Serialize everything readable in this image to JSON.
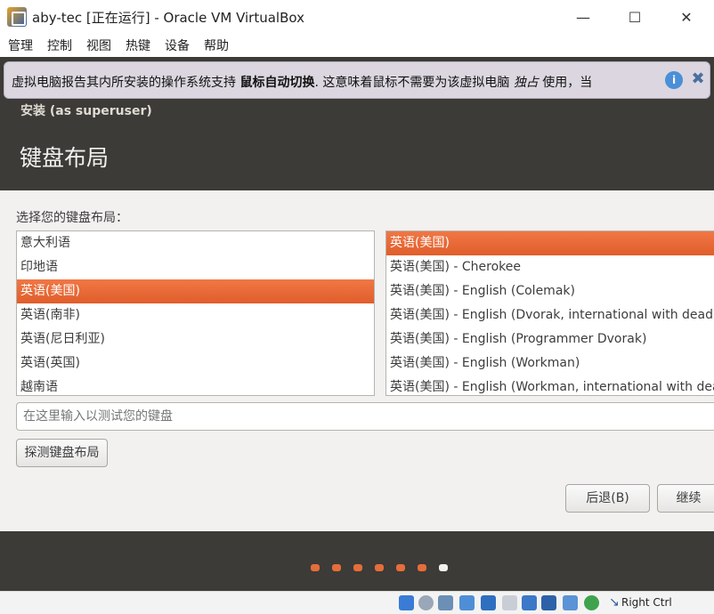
{
  "window": {
    "title": "aby-tec [正在运行] - Oracle VM VirtualBox",
    "minimize": "—",
    "maximize": "☐",
    "close": "✕"
  },
  "menubar": {
    "items": [
      "管理",
      "控制",
      "视图",
      "热键",
      "设备",
      "帮助"
    ]
  },
  "notice": {
    "text_before": "虚拟电脑报告其内所安装的操作系统支持 ",
    "bold": "鼠标自动切换",
    "text_middle": ". 这意味着鼠标不需要为该虚拟电脑 ",
    "italic": "独占",
    "text_after": " 使用，当"
  },
  "installer": {
    "label": "安装 (as superuser)",
    "heading": "键盘布局"
  },
  "layout_page": {
    "prompt": "选择您的键盘布局：",
    "languages": [
      "意大利语",
      "印地语",
      "英语(美国)",
      "英语(南非)",
      "英语(尼日利亚)",
      "英语(英国)",
      "越南语"
    ],
    "selected_language_index": 2,
    "variants": [
      "英语(美国)",
      "英语(美国) - Cherokee",
      "英语(美国) - English (Colemak)",
      "英语(美国) - English (Dvorak, international with dead keys)",
      "英语(美国) - English (Programmer Dvorak)",
      "英语(美国) - English (Workman)",
      "英语(美国) - English (Workman, international with dead keys)"
    ],
    "selected_variant_index": 0,
    "test_placeholder": "在这里输入以测试您的键盘",
    "detect_button": "探测键盘布局",
    "back_button": "后退(B)",
    "continue_button": "继续"
  },
  "progress": {
    "total_steps": 7,
    "current_step": 7
  },
  "statusbar": {
    "host_key": "Right Ctrl"
  },
  "colors": {
    "accent": "#e6692f",
    "header_bg": "#3c3b37",
    "window_bg": "#f2f1f0"
  }
}
